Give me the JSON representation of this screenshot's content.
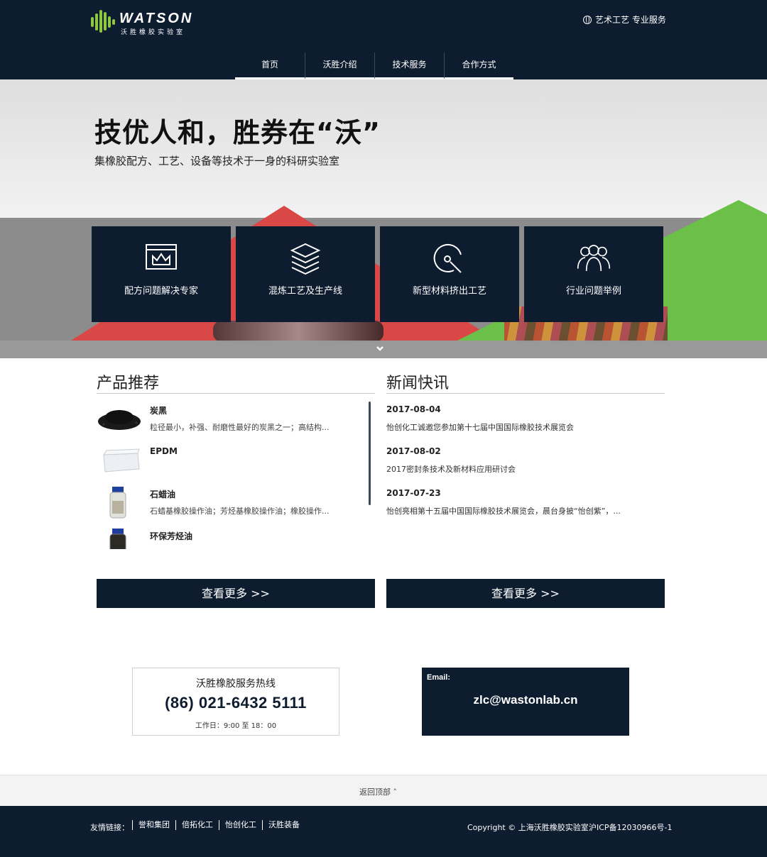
{
  "header": {
    "logo_word": "WATSON",
    "logo_sub": "沃胜橡胶实验室",
    "service_text": "艺术工艺 专业服务",
    "nav": [
      "首页",
      "沃胜介绍",
      "技术服务",
      "合作方式"
    ]
  },
  "hero": {
    "title": "技优人和，胜券在“沃”",
    "subtitle": "集橡胶配方、工艺、设备等技术于一身的科研实验室",
    "features": [
      {
        "label": "配方问题解决专家",
        "icon": "window-crown-icon"
      },
      {
        "label": "混炼工艺及生产线",
        "icon": "layers-icon"
      },
      {
        "label": "新型材料挤出工艺",
        "icon": "disc-search-icon"
      },
      {
        "label": "行业问题举例",
        "icon": "users-icon"
      }
    ]
  },
  "products": {
    "title": "产品推荐",
    "items": [
      {
        "name": "炭黑",
        "desc": "粒径最小，补强、耐磨性最好的炭黑之一；高结构...",
        "thumb": "carbon-black-image"
      },
      {
        "name": "EPDM",
        "desc": "",
        "thumb": "epdm-block-image"
      },
      {
        "name": "石蜡油",
        "desc": "石蜡基橡胶操作油；芳烃基橡胶操作油；橡胶操作...",
        "thumb": "oil-bottle-image"
      },
      {
        "name": "环保芳烃油",
        "desc": "",
        "thumb": "aromatic-oil-bottle-image"
      }
    ],
    "more_label": "查看更多 >>"
  },
  "news": {
    "title": "新闻快讯",
    "items": [
      {
        "date": "2017-08-04",
        "title": "怡创化工诚邀您参加第十七届中国国际橡胶技术展览会"
      },
      {
        "date": "2017-08-02",
        "title": "2017密封条技术及新材料应用研讨会"
      },
      {
        "date": "2017-07-23",
        "title": "怡创亮相第十五届中国国际橡胶技术展览会，晨台身披“怡创紫”，..."
      }
    ],
    "more_label": "查看更多 >>"
  },
  "contact": {
    "hotline_label": "沃胜橡胶服务热线",
    "hotline_number": "(86) 021-6432 5111",
    "hours": "工作日：9:00 至 18：00",
    "email_label": "Email:",
    "email": "zlc@wastonlab.cn"
  },
  "backtop": "返回顶部 ˄",
  "footer": {
    "links_label": "友情链接：",
    "links": [
      "誉和集团",
      "倍拓化工",
      "怡创化工",
      "沃胜装备"
    ],
    "copyright": "Copyright © 上海沃胜橡胶实验室",
    "icp": "沪ICP备12030966号-1"
  },
  "colors": {
    "navy": "#0d1c2f",
    "logo_green": "#8dc63f",
    "hero_red": "#d94747",
    "hero_green": "#6cbf49"
  }
}
